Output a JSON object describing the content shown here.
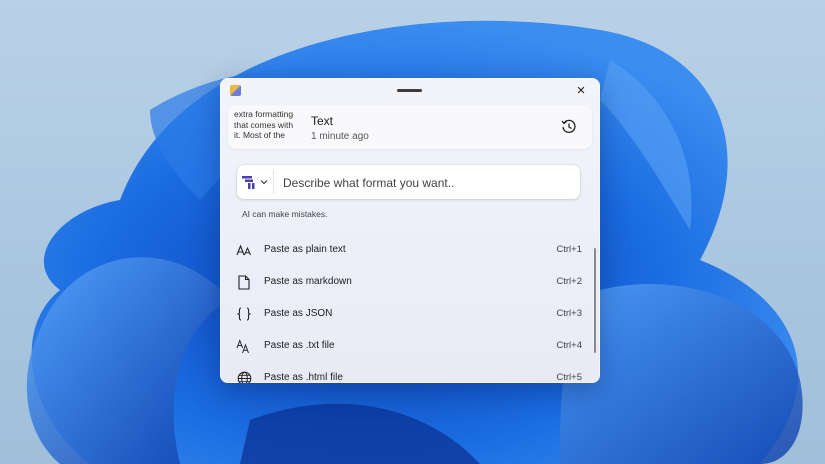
{
  "clip": {
    "preview": "extra formatting that comes with it. Most of the",
    "title": "Text",
    "time": "1 minute ago"
  },
  "prompt": {
    "placeholder": "Describe what format you want.."
  },
  "disclaimer": "AI can make mistakes.",
  "options": [
    {
      "label": "Paste as plain text",
      "shortcut": "Ctrl+1",
      "icon": "font-size-icon"
    },
    {
      "label": "Paste as markdown",
      "shortcut": "Ctrl+2",
      "icon": "document-icon"
    },
    {
      "label": "Paste as JSON",
      "shortcut": "Ctrl+3",
      "icon": "braces-icon"
    },
    {
      "label": "Paste as .txt file",
      "shortcut": "Ctrl+4",
      "icon": "text-file-icon"
    },
    {
      "label": "Paste as .html file",
      "shortcut": "Ctrl+5",
      "icon": "globe-icon"
    }
  ],
  "icons": {
    "close": "×"
  },
  "colors": {
    "accent": "#4b3fb0"
  }
}
